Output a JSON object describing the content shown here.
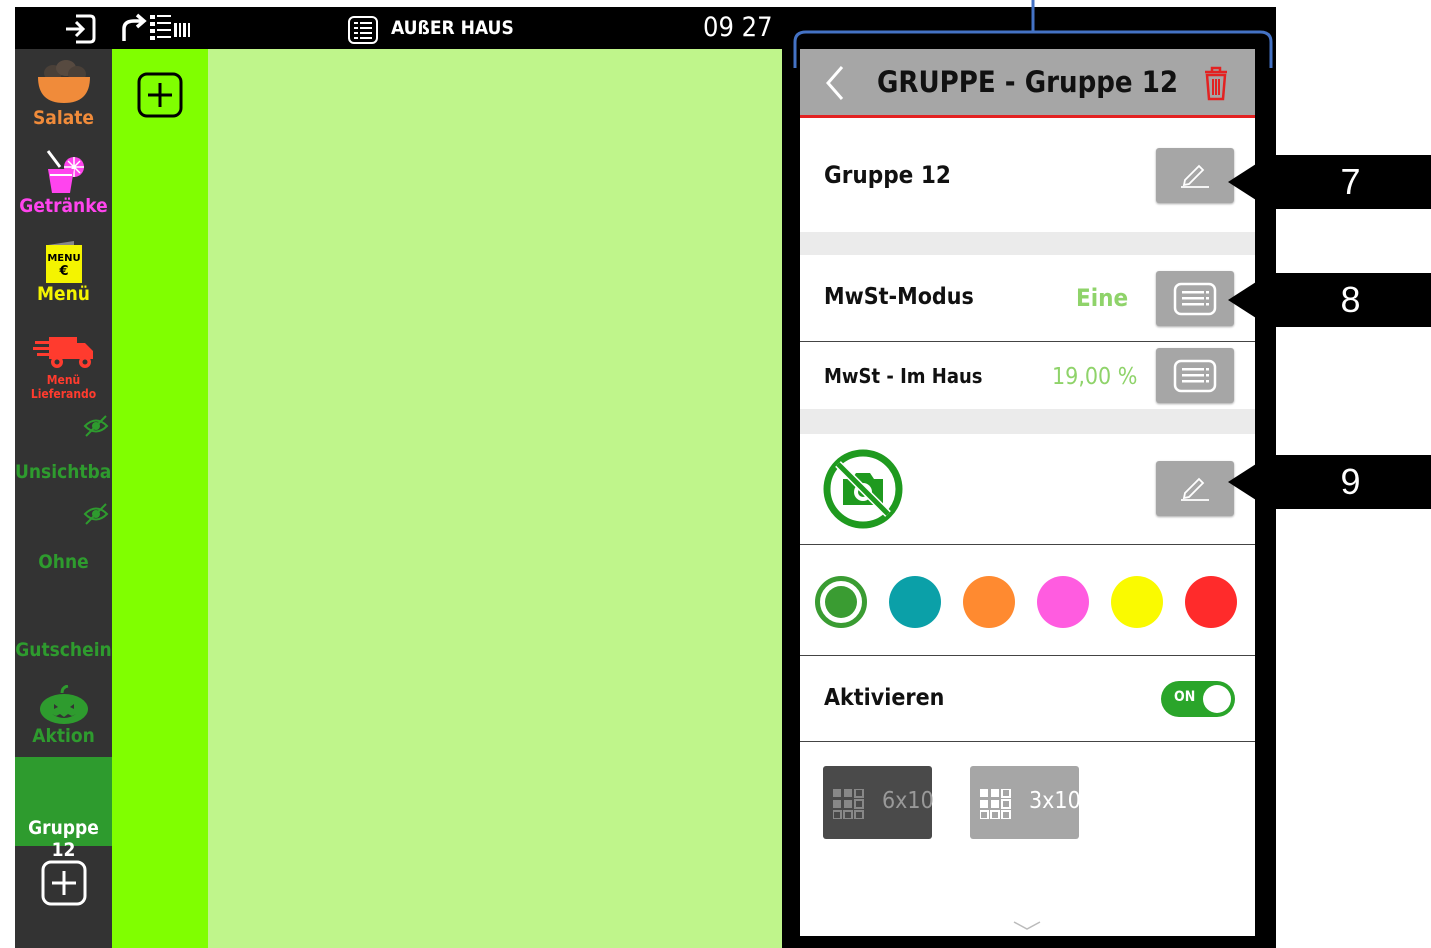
{
  "topbar": {
    "order_mode": "AUßER HAUS",
    "time": "09 27"
  },
  "sidebar": {
    "items": [
      {
        "label": "Salate",
        "color": "#f08b3a",
        "icon": "salad-bowl-icon"
      },
      {
        "label": "Getränke",
        "color": "#ff44ee",
        "icon": "drink-icon"
      },
      {
        "label": "Menü",
        "color": "#f4f400",
        "icon": "menu-card-icon",
        "icon_text": "MENU",
        "icon_symbol": "€"
      },
      {
        "label": "Menü Lieferando",
        "color": "#ff3b2e",
        "icon": "delivery-truck-icon"
      },
      {
        "label": "Unsichtbar",
        "color": "#2e9b2e",
        "icon": "hidden-eye-icon"
      },
      {
        "label": "Ohne",
        "color": "#2e9b2e",
        "icon": "hidden-eye-icon"
      },
      {
        "label": "Gutschein",
        "color": "#2e9b2e",
        "icon": ""
      },
      {
        "label": "Aktion",
        "color": "#2e9b2e",
        "icon": "pumpkin-icon"
      },
      {
        "label": "Gruppe 12",
        "color": "#ffffff",
        "icon": "",
        "selected": true
      }
    ]
  },
  "panel": {
    "title": "GRUPPE - Gruppe 12",
    "name_value": "Gruppe 12",
    "vat_mode_label": "MwSt-Modus",
    "vat_mode_value": "Eine",
    "vat_inhouse_label": "MwSt - Im Haus",
    "vat_inhouse_value": "19,00 %",
    "colors": [
      "#3a9c32",
      "#0ba0a8",
      "#ff8a30",
      "#ff5ce0",
      "#fafa00",
      "#ff2b2b"
    ],
    "selected_color_index": 0,
    "activate_label": "Aktivieren",
    "activate_toggle": "ON",
    "activate_on": true,
    "layout_options": [
      {
        "label": "6x10",
        "selected": true
      },
      {
        "label": "3x10",
        "selected": false
      }
    ]
  },
  "callouts": [
    "7",
    "8",
    "9"
  ]
}
